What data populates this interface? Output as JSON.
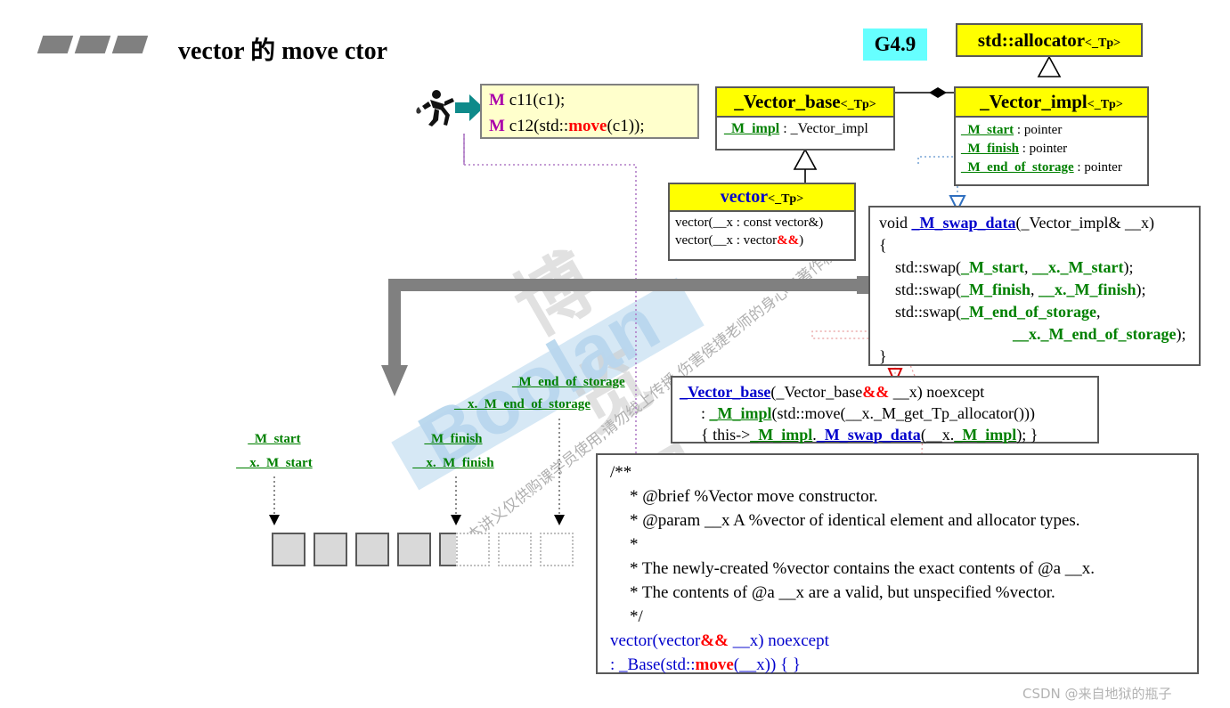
{
  "page": {
    "title": "vector 的 move ctor",
    "version_badge": "G4.9",
    "watermark_brand": "Boolan",
    "watermark_cn": "本讲义仅供购课学员使用,请勿线上传播,伤害侯捷老师的身心与著作权",
    "watermark_cn2": "博览网",
    "footer_credit": "CSDN @来自地狱的瓶子"
  },
  "call_box": {
    "line1_prefix": "M",
    "line1_rest": " c11(c1);",
    "line2_prefix": "M",
    "line2_a": " c12(std::",
    "line2_move": "move",
    "line2_b": "(c1));"
  },
  "allocator_class": {
    "name": "std::allocator",
    "template": "<_Tp>"
  },
  "vector_base_class": {
    "name": "_Vector_base",
    "template": "<_Tp>",
    "members": [
      {
        "name": "_M_impl",
        "type": ": _Vector_impl"
      }
    ]
  },
  "vector_impl_class": {
    "name": "_Vector_impl",
    "template": "<_Tp>",
    "members": [
      {
        "name": "_M_start",
        "type": ": pointer"
      },
      {
        "name": "_M_finish",
        "type": ": pointer"
      },
      {
        "name": "_M_end_of_storage",
        "type": ": pointer"
      }
    ]
  },
  "vector_class": {
    "name": "vector",
    "template": "<_Tp>",
    "ctors": [
      {
        "pre": "vector(__x : const vector&)",
        "amp": ""
      },
      {
        "pre": "vector(__x : vector",
        "amp": "&&",
        "post": ")"
      }
    ]
  },
  "swap_data_code": {
    "sig_void": "void ",
    "sig_name": "_M_swap_data",
    "sig_args": "(_Vector_impl& __x)",
    "open_brace": "{",
    "lines": [
      {
        "pre": "std::swap(",
        "a": "_M_start",
        "mid": ", ",
        "b": "__x._M_start",
        "post": ");"
      },
      {
        "pre": "std::swap(",
        "a": "_M_finish",
        "mid": ", ",
        "b": "__x._M_finish",
        "post": ");"
      },
      {
        "pre": "std::swap(",
        "a": "_M_end_of_storage",
        "mid": ",",
        "b": "",
        "post": ""
      },
      {
        "pre": "",
        "a": "",
        "mid": "",
        "b": "__x._M_end_of_storage",
        "post": ");"
      }
    ],
    "close_brace": "}"
  },
  "vector_base_ctor_code": {
    "l1_name": "_Vector_base",
    "l1_a": "(_Vector_base",
    "l1_amp": "&&",
    "l1_b": " __x) noexcept",
    "l2_colon": ": ",
    "l2_impl": "_M_impl",
    "l2_rest": "(std::move(__x._M_get_Tp_allocator()))",
    "l3_a": "{ this->",
    "l3_impl": "_M_impl",
    "l3_dot": ".",
    "l3_swap": "_M_swap_data",
    "l3_b": "(__x.",
    "l3_impl2": "_M_impl",
    "l3_c": "); }"
  },
  "doc_box": {
    "lines": [
      "/**",
      " *  @brief  %Vector move constructor.",
      " *  @param  __x  A %vector of identical element and allocator types.",
      " *",
      " *  The newly-created %vector contains the exact contents of @a __x.",
      " *  The contents of @a __x are a valid, but unspecified %vector.",
      " */"
    ],
    "sig_a": "vector(vector",
    "sig_amp": "&&",
    "sig_b": " __x) noexcept",
    "init_a": "  : _Base(std::",
    "init_move": "move",
    "init_b": "(__x)) { }"
  },
  "memory": {
    "labels": [
      {
        "top": "_M_start",
        "bottom": "__x._M_start"
      },
      {
        "top": "_M_finish",
        "bottom": "__x._M_finish"
      },
      {
        "top": "_M_end_of_storage",
        "bottom": "__x._M_end_of_storage"
      }
    ],
    "cells_filled": 5,
    "cells_empty": 3
  },
  "colors": {
    "class_header": "#ffff00",
    "call_box_bg": "#ffffcc",
    "badge_bg": "#66ffff",
    "member_green": "#008000",
    "keyword_red": "#ff0000",
    "name_blue": "#0000cc",
    "m_magenta": "#aa00aa",
    "arrow_gray": "#808080",
    "arrow_teal": "#008b8b"
  }
}
